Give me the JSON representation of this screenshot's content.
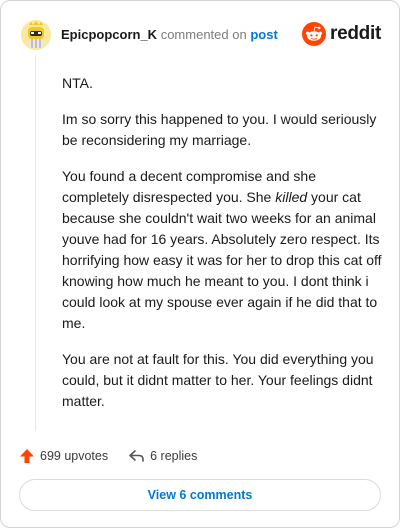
{
  "comment": {
    "author": "Epicpopcorn_K",
    "commented_text": "commented on",
    "post_link": "post",
    "paragraphs": [
      {
        "text": "NTA."
      },
      {
        "text": "Im so sorry this happened to you. I would seriously be reconsidering my marriage."
      },
      {
        "before": "You found a decent compromise and she completely disrespected you. She ",
        "emphasis": "killed",
        "after": " your cat because she couldn't wait two weeks for an animal youve had for 16 years. Absolutely zero respect. Its horrifying how easy it was for her to drop this cat off knowing how much he meant to you. I dont think i could look at my spouse ever again if he did that to me."
      },
      {
        "text": "You are not at fault for this. You did everything you could, but it didnt matter to her. Your feelings didnt matter."
      }
    ]
  },
  "brand": {
    "wordmark": "reddit",
    "accent": "#ff4500"
  },
  "footer": {
    "upvotes": "699 upvotes",
    "replies": "6 replies",
    "view_comments": "View 6 comments"
  },
  "icons": [
    "avatar-popcorn",
    "reddit-alien-icon",
    "upvote-arrow-icon",
    "reply-arrow-icon"
  ],
  "colors": {
    "link": "#0079d3",
    "upvote": "#ff4500",
    "text": "#1a1a1b",
    "muted": "#7c7c7c"
  }
}
